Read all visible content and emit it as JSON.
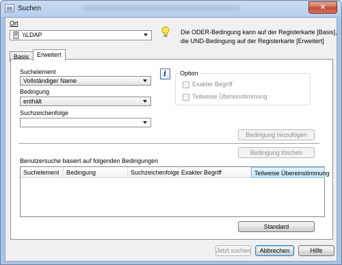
{
  "window": {
    "title": "Suchen",
    "close_glyph": "✕"
  },
  "location": {
    "label": "Ort",
    "value": "\\\\LDAP",
    "icon": "ldap-server-icon"
  },
  "info": {
    "icon": "lightbulb-icon",
    "text_line1": "Die ODER-Bedingung kann auf der Registerkarte [Basis],",
    "text_line2": "die UND-Bedingung auf der Registerkarte [Erweitert]"
  },
  "tabs": [
    {
      "label": "Basis",
      "active": false
    },
    {
      "label": "Erweitert",
      "active": true
    }
  ],
  "advanced": {
    "search_element_label": "Suchelement",
    "search_element_value": "Vollständiger Name",
    "condition_label": "Bedingung",
    "condition_value": "enthält",
    "search_string_label": "Suchzeichenfolge",
    "search_string_value": "",
    "option_icon": "info-icon",
    "option_title": "Option",
    "exact_term": {
      "label": "Exakter Begriff",
      "checked": false,
      "enabled": false
    },
    "partial_match": {
      "label": "Teilweise Übereinstimmung",
      "checked": false,
      "enabled": false
    },
    "add_condition_button": "Bedingung hinzufügen",
    "delete_condition_button": "Bedingung löschen",
    "list_caption": "Benutzersuche basiert auf folgenden Bedingungen",
    "list_columns": [
      "Suchelement",
      "Bedingung",
      "Suchzeichenfolge",
      "Exakter Begriff",
      "Teilweise Übereinstimmung"
    ],
    "list_rows": [],
    "default_button": "Standard"
  },
  "footer": {
    "search_now_button": "Jetzt suchen",
    "cancel_button": "Abbrechen",
    "help_button": "Hilfe"
  }
}
